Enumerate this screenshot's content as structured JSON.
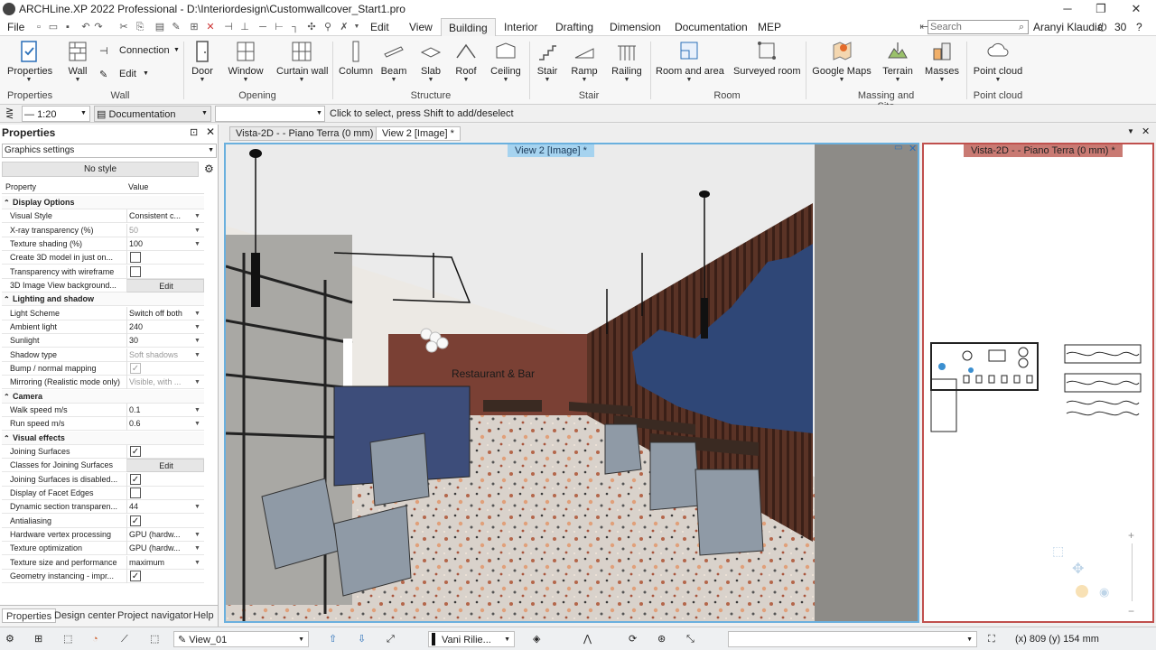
{
  "titlebar": {
    "title": "ARCHLine.XP 2022 Professional - D:\\Interiordesign\\Customwallcover_Start1.pro"
  },
  "menu": {
    "file": "File",
    "tabs": [
      "Edit",
      "View",
      "Building",
      "Interior",
      "Drafting",
      "Dimension",
      "Documentation",
      "MEP"
    ],
    "active_tab": "Building",
    "search_placeholder": "Search",
    "user": "Aranyi Klaudia",
    "counter": "30"
  },
  "ribbon": {
    "properties": "Properties",
    "wall": "Wall",
    "connection": "Connection",
    "edit": "Edit",
    "door": "Door",
    "window": "Window",
    "curtain_wall": "Curtain wall",
    "column": "Column",
    "beam": "Beam",
    "slab": "Slab",
    "roof": "Roof",
    "ceiling": "Ceiling",
    "stair": "Stair",
    "ramp": "Ramp",
    "railing": "Railing",
    "room_and_area": "Room and area",
    "surveyed_room": "Surveyed room",
    "google_maps": "Google Maps",
    "terrain": "Terrain",
    "masses": "Masses",
    "point_cloud": "Point cloud",
    "groups": [
      "Properties",
      "Wall",
      "Opening",
      "Structure",
      "Stair",
      "Room",
      "Massing and Site",
      "Point cloud"
    ]
  },
  "toolbar2": {
    "scale": "1:20",
    "style": "Documentation",
    "hint": "Click to select, press Shift to add/deselect"
  },
  "panel": {
    "title": "Properties",
    "graphics": "Graphics settings",
    "no_style": "No style",
    "col_property": "Property",
    "col_value": "Value",
    "rows": [
      {
        "k": "Display Options",
        "sec": true
      },
      {
        "k": "Visual Style",
        "v": "Consistent c...",
        "arr": true
      },
      {
        "k": "X-ray transparency (%)",
        "v": "50",
        "dis": true,
        "arr": true
      },
      {
        "k": "Texture shading (%)",
        "v": "100",
        "arr": true
      },
      {
        "k": "Create 3D model in just on...",
        "chk": false
      },
      {
        "k": "Transparency with wireframe",
        "chk": false
      },
      {
        "k": "3D Image View background...",
        "btn": "Edit"
      },
      {
        "k": "Lighting and shadow",
        "sec": true
      },
      {
        "k": "Light Scheme",
        "v": "Switch off both",
        "arr": true
      },
      {
        "k": "Ambient light",
        "v": "240",
        "arr": true
      },
      {
        "k": "Sunlight",
        "v": "30",
        "arr": true
      },
      {
        "k": "Shadow type",
        "v": "Soft shadows",
        "dis": true,
        "arr": true
      },
      {
        "k": "Bump / normal mapping",
        "chk": true,
        "dis": true
      },
      {
        "k": "Mirroring (Realistic mode only)",
        "v": "Visible, with ...",
        "dis": true,
        "arr": true
      },
      {
        "k": "Camera",
        "sec": true
      },
      {
        "k": "Walk speed m/s",
        "v": "0.1",
        "arr": true
      },
      {
        "k": "Run speed m/s",
        "v": "0.6",
        "arr": true
      },
      {
        "k": "Visual effects",
        "sec": true
      },
      {
        "k": "Joining Surfaces",
        "chk": true
      },
      {
        "k": "Classes for Joining Surfaces",
        "btn": "Edit"
      },
      {
        "k": "Joining Surfaces is disabled...",
        "chk": true
      },
      {
        "k": "Display of Facet Edges",
        "chk": false
      },
      {
        "k": "Dynamic section transparen...",
        "v": "44",
        "arr": true
      },
      {
        "k": "Antialiasing",
        "chk": true
      },
      {
        "k": "Hardware vertex processing",
        "v": "GPU (hardw...",
        "arr": true
      },
      {
        "k": "Texture optimization",
        "v": "GPU (hardw...",
        "arr": true
      },
      {
        "k": "Texture size and performance",
        "v": "maximum",
        "arr": true
      },
      {
        "k": "Geometry instancing -  impr...",
        "chk": true
      }
    ],
    "tabs": [
      "Properties",
      "Design center",
      "Project navigator",
      "Help"
    ]
  },
  "doctabs": {
    "tab1": "Vista-2D -  - Piano Terra (0 mm) *",
    "tab2": "View 2 [Image] *"
  },
  "view3d": {
    "label": "View 2 [Image] *",
    "sign": "Restaurant & Bar"
  },
  "view2d": {
    "label": "Vista-2D -  - Piano Terra (0 mm) *"
  },
  "statusbar": {
    "view": "View_01",
    "layer": "Vani Rilie...",
    "coords": "(x) 809  (y) 154 mm"
  }
}
